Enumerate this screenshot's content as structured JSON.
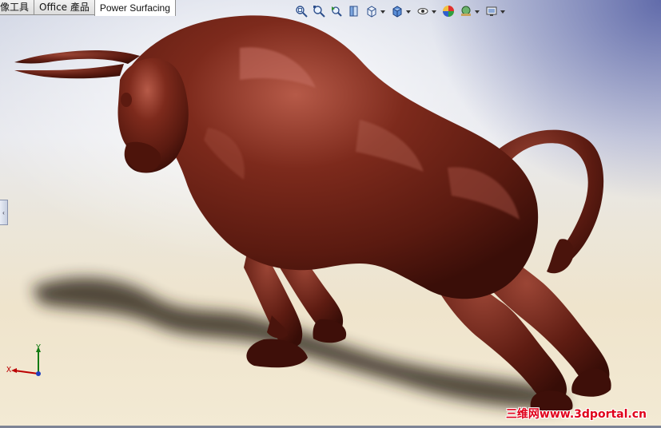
{
  "tabs": [
    {
      "label": "像工具"
    },
    {
      "label": "Office 產品"
    },
    {
      "label": "Power Surfacing",
      "active": true
    }
  ],
  "heads_up_toolbar": [
    {
      "icon": "zoom-to-fit-icon"
    },
    {
      "icon": "zoom-to-area-icon"
    },
    {
      "icon": "previous-view-icon"
    },
    {
      "icon": "section-view-icon"
    },
    {
      "icon": "view-orientation-icon",
      "dropdown": true
    },
    {
      "icon": "display-style-icon",
      "dropdown": true
    },
    {
      "icon": "hide-show-items-icon",
      "dropdown": true
    },
    {
      "icon": "edit-appearance-icon"
    },
    {
      "icon": "apply-scene-icon",
      "dropdown": true
    },
    {
      "icon": "view-settings-icon",
      "dropdown": true
    }
  ],
  "triad": {
    "x_label": "X",
    "y_label": "Y"
  },
  "watermark": "三维网www.3dportal.cn",
  "colors": {
    "model": "#5a1a10",
    "watermark": "#e0001b",
    "viewport_top": "#3a4696",
    "viewport_floor": "#f3ead4"
  }
}
